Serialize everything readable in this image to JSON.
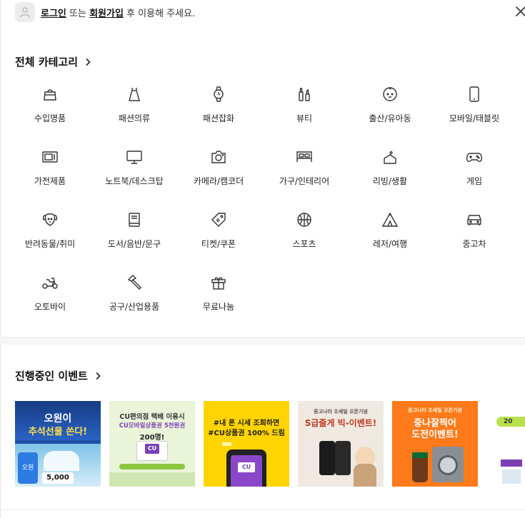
{
  "topbar": {
    "login_link": "로그인",
    "text_or": " 또는 ",
    "signup_link": "회원가입",
    "text_suffix": " 후 이용해 주세요."
  },
  "categories_section": {
    "title": "전체 카테고리"
  },
  "categories": [
    {
      "label": "수입명품",
      "icon": "handbag-icon"
    },
    {
      "label": "패션의류",
      "icon": "dress-icon"
    },
    {
      "label": "패션잡화",
      "icon": "watch-icon"
    },
    {
      "label": "뷰티",
      "icon": "cosmetics-icon"
    },
    {
      "label": "출산/유아동",
      "icon": "baby-icon"
    },
    {
      "label": "모바일/태블릿",
      "icon": "phone-icon"
    },
    {
      "label": "가전제품",
      "icon": "microwave-icon"
    },
    {
      "label": "노트북/데스크탑",
      "icon": "monitor-icon"
    },
    {
      "label": "카메라/캠코더",
      "icon": "camera-icon"
    },
    {
      "label": "가구/인테리어",
      "icon": "bed-icon"
    },
    {
      "label": "리빙/생활",
      "icon": "hanger-icon"
    },
    {
      "label": "게임",
      "icon": "gamepad-icon"
    },
    {
      "label": "반려동물/취미",
      "icon": "dog-icon"
    },
    {
      "label": "도서/음반/문구",
      "icon": "book-icon"
    },
    {
      "label": "티켓/쿠폰",
      "icon": "ticket-icon"
    },
    {
      "label": "스포츠",
      "icon": "basketball-icon"
    },
    {
      "label": "레저/여행",
      "icon": "tent-icon"
    },
    {
      "label": "중고차",
      "icon": "car-icon"
    },
    {
      "label": "오토바이",
      "icon": "motorbike-icon"
    },
    {
      "label": "공구/산업용품",
      "icon": "hammer-icon"
    },
    {
      "label": "무료나눔",
      "icon": "gift-icon"
    }
  ],
  "events_section": {
    "title": "진행중인 이벤트"
  },
  "events": [
    {
      "lines": [
        "오원이",
        "추석선물 쏜다!"
      ],
      "sub": "오원",
      "price": "5,000",
      "bg": "#1f4fa3"
    },
    {
      "lines": [
        "CU편의점 택배 이용시",
        "CU모바일상품권 5천원권",
        "200명!"
      ],
      "sub": "CU",
      "bg": "#e9f4d9"
    },
    {
      "lines": [
        "#내 폰 시세 조회하면",
        "#CU상품권 100% 드림"
      ],
      "sub": "CU",
      "bg": "#ffd400"
    },
    {
      "lines": [
        "중고나라 조세일 오픈기념",
        "S급줄게 빅-이벤트!"
      ],
      "bg": "#efe9e2"
    },
    {
      "lines": [
        "중고나라 조세일 오픈기념",
        "중나잘찍어",
        "도전이벤트!"
      ],
      "bg": "#ff7a1a"
    },
    {
      "lines": [
        "20"
      ],
      "bg": "#ffffff"
    }
  ],
  "colors": {
    "accent": "#ff7a1a",
    "cu_purple": "#7b3fb6",
    "cu_green": "#8cc63f"
  }
}
